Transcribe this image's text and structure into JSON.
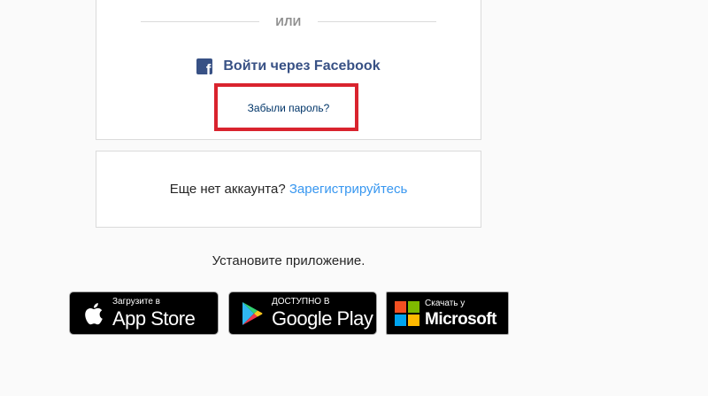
{
  "login": {
    "divider": "ИЛИ",
    "facebook_label": "Войти через Facebook",
    "forgot_password": "Забыли пароль?"
  },
  "signup": {
    "prompt": "Еще нет аккаунта?",
    "link": "Зарегистрируйтесь"
  },
  "app": {
    "install_text": "Установите приложение.",
    "appstore": {
      "small": "Загрузите в",
      "big": "App Store"
    },
    "googleplay": {
      "small": "ДОСТУПНО В",
      "big": "Google Play"
    },
    "microsoft": {
      "small": "Скачать у",
      "big": "Microsoft"
    }
  },
  "colors": {
    "facebook": "#385185",
    "link": "#3897f0",
    "highlight": "#d9232e"
  }
}
